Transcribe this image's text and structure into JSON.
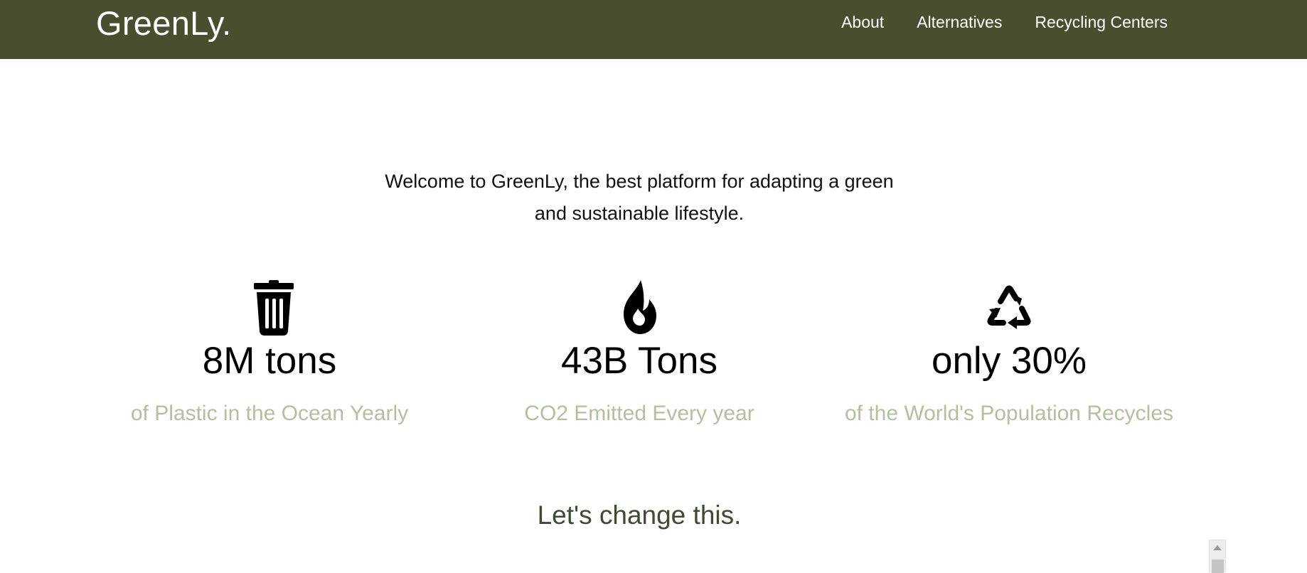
{
  "header": {
    "brand": "GreenLy.",
    "nav": [
      {
        "label": "About"
      },
      {
        "label": "Alternatives"
      },
      {
        "label": "Recycling Centers"
      }
    ],
    "background_color": "#484f2f"
  },
  "intro": {
    "line1": "Welcome to GreenLy, the best platform for adapting a green",
    "line2": "and sustainable lifestyle."
  },
  "stats": [
    {
      "icon": "trash-icon",
      "value": "8M tons",
      "caption": "of Plastic in the Ocean Yearly"
    },
    {
      "icon": "fire-icon",
      "value": "43B Tons",
      "caption": "CO2 Emitted Every year"
    },
    {
      "icon": "recycle-icon",
      "value": "only 30%",
      "caption": "of the World's Population Recycles"
    }
  ],
  "cta": {
    "text": "Let's change this."
  },
  "colors": {
    "caption": "#b2c0a0",
    "cta": "#3f4a33"
  }
}
